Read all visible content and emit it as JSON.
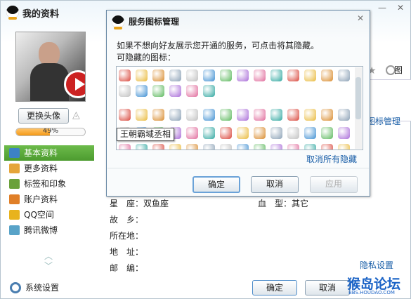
{
  "main": {
    "title": "我的资料",
    "change_avatar": "更换头像",
    "progress": {
      "percent": 49,
      "label": "49%"
    },
    "nav": [
      {
        "label": "基本资料",
        "icon": "card-icon",
        "color": "#3d82c5",
        "active": true
      },
      {
        "label": "更多资料",
        "icon": "more-info-icon",
        "color": "#e5a53a",
        "active": false
      },
      {
        "label": "标签和印象",
        "icon": "tag-icon",
        "color": "#6aa13b",
        "active": false
      },
      {
        "label": "账户资料",
        "icon": "account-icon",
        "color": "#e07f28",
        "active": false
      },
      {
        "label": "QQ空间",
        "icon": "star-icon",
        "color": "#e8b31c",
        "active": false
      },
      {
        "label": "腾讯微博",
        "icon": "weibo-icon",
        "color": "#58a3c8",
        "active": false
      }
    ],
    "system_settings": "系统设置",
    "right_label": "图",
    "icon_manage_link": "图标管理",
    "fields": {
      "star_sign": "星　座：双鱼座",
      "blood_type": "血　型：其它",
      "hometown": "故　乡：",
      "location": "所在地：",
      "address": "地　址：",
      "postcode": "邮　编："
    },
    "privacy_link": "隐私设置",
    "ok": "确定",
    "cancel": "取消",
    "watermark": "猴岛论坛",
    "watermark_sub": "BBS.HOUDAO.COM"
  },
  "dialog": {
    "title": "服务图标管理",
    "description": "如果不想向好友展示您开通的服务，可点击将其隐藏。",
    "hideable_label": "可隐藏的图标：",
    "tooltip": "王朝霸域丞相",
    "cancel_all_hidden": "取消所有隐藏",
    "ok": "确定",
    "cancel": "取消",
    "apply": "应用",
    "icon_colors": [
      "#d9463b",
      "#e9b93a",
      "#d98a2b",
      "#8aa0b5",
      "#c0c0c0",
      "#3f8fd2",
      "#5bb85c",
      "#a96cd8",
      "#e06a9b",
      "#2fa7a0"
    ]
  }
}
